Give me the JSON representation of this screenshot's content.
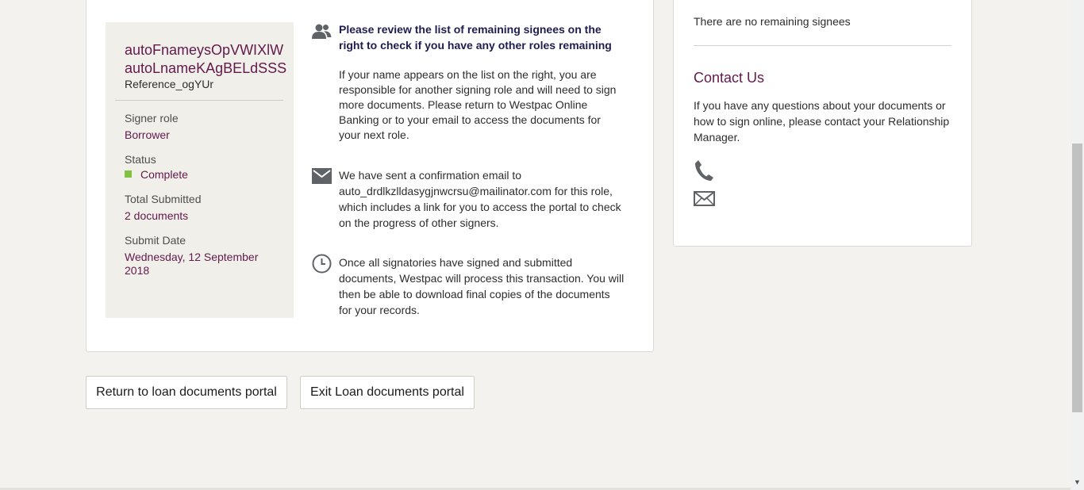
{
  "signer": {
    "first_name": "autoFnameysOpVWIXlW",
    "last_name": "autoLnameKAgBELdSSS",
    "reference": "Reference_ogYUr",
    "role_label": "Signer role",
    "role_value": "Borrower",
    "status_label": "Status",
    "status_value": "Complete",
    "status_color": "#81c240",
    "total_label": "Total Submitted",
    "total_value": "2 documents",
    "date_label": "Submit Date",
    "date_value": "Wednesday, 12 September 2018"
  },
  "info": {
    "review_heading": "Please review the list of remaining signees on the right to check if you have any other roles remaining",
    "review_body": "If your name appears on the list on the right, you are responsible for another signing role and will need to sign more documents. Please return to Westpac Online Banking or to your email to access the documents for your next role.",
    "email_text": "We have sent a confirmation email to auto_drdlkzlldasygjnwcrsu@mailinator.com for this role, which includes a link for you to access the portal to check on the progress of other signers.",
    "process_text": "Once all signatories have signed and submitted documents, Westpac will process this transaction. You will then be able to download final copies of the documents for your records.",
    "icons": [
      "people-icon",
      "mail-icon",
      "clock-icon"
    ]
  },
  "sidebar": {
    "no_signees": "There are no remaining signees",
    "contact_title": "Contact Us",
    "contact_text": "If you have any questions about your documents or how to sign online, please contact your Relationship Manager.",
    "icons": [
      "phone-icon",
      "envelope-icon"
    ]
  },
  "actions": {
    "return_label": "Return to loan documents portal",
    "exit_label": "Exit Loan documents portal"
  },
  "colors": {
    "brand": "#621a4b",
    "background": "#f3f2ef",
    "panel": "#f1efea"
  }
}
